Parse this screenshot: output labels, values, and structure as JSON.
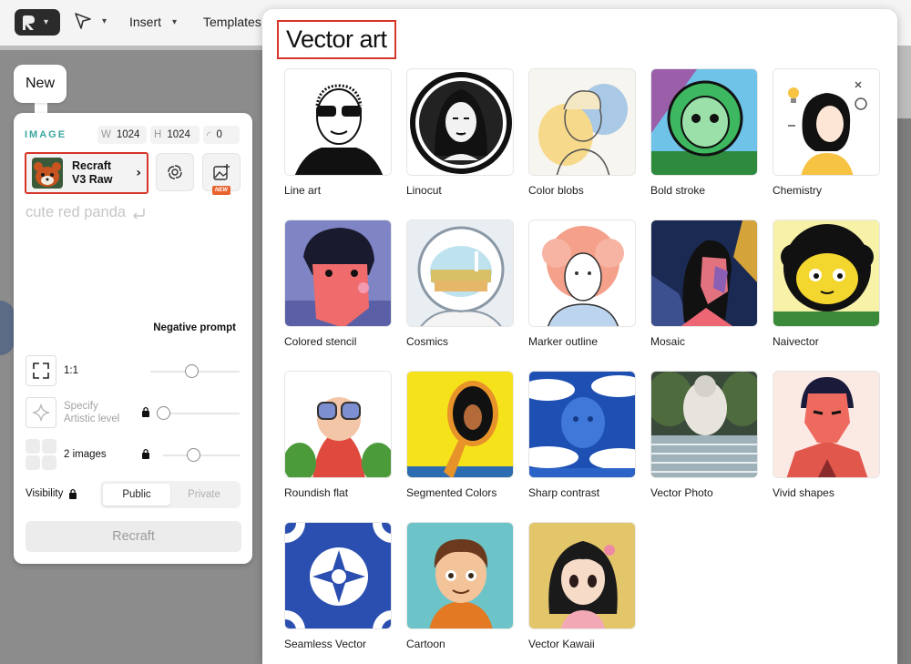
{
  "topbar": {
    "menu": [
      {
        "label": "Insert"
      },
      {
        "label": "Templates"
      }
    ]
  },
  "new_label": "New",
  "panel": {
    "section_label": "IMAGE",
    "width": {
      "key": "W",
      "value": "1024"
    },
    "height": {
      "key": "H",
      "value": "1024"
    },
    "seed": {
      "value": "0"
    },
    "model": {
      "line1": "Recraft",
      "line2": "V3 Raw"
    },
    "new_badge": "NEW",
    "prompt": "cute red panda",
    "negative_prompt_label": "Negative prompt",
    "aspect_ratio": "1:1",
    "artistic_level_line1": "Specify",
    "artistic_level_line2": "Artistic level",
    "images_count": "2 images",
    "visibility_label": "Visibility",
    "visibility_options": [
      "Public",
      "Private"
    ],
    "visibility_selected": "Public",
    "recraft_button": "Recraft",
    "sliders": {
      "aspect_ratio": 0.4,
      "artistic_level": 0.0,
      "images": 0.4
    }
  },
  "gallery": {
    "title": "Vector art",
    "styles": [
      {
        "name": "Line art"
      },
      {
        "name": "Linocut"
      },
      {
        "name": "Color blobs"
      },
      {
        "name": "Bold stroke"
      },
      {
        "name": "Chemistry"
      },
      {
        "name": "Colored stencil"
      },
      {
        "name": "Cosmics"
      },
      {
        "name": "Marker outline"
      },
      {
        "name": "Mosaic"
      },
      {
        "name": "Naivector"
      },
      {
        "name": "Roundish flat"
      },
      {
        "name": "Segmented Colors"
      },
      {
        "name": "Sharp contrast"
      },
      {
        "name": "Vector Photo"
      },
      {
        "name": "Vivid shapes"
      },
      {
        "name": "Seamless Vector"
      },
      {
        "name": "Cartoon"
      },
      {
        "name": "Vector Kawaii"
      }
    ]
  },
  "colors": {
    "accent_teal": "#3aa6a1",
    "highlight_red": "#d8352a",
    "new_badge_orange": "#e9622e"
  }
}
